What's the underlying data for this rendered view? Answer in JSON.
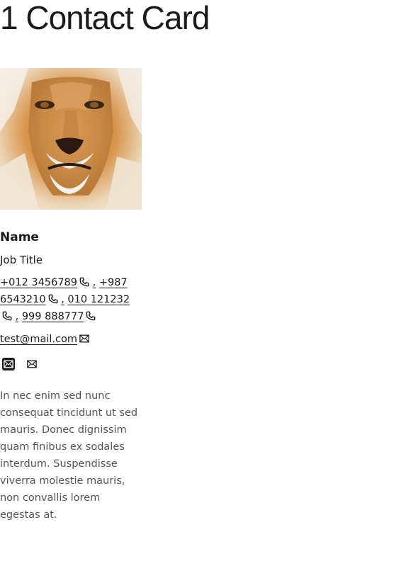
{
  "page": {
    "title": "1 Contact Card"
  },
  "card": {
    "photo_alt": "lion portrait",
    "name": "Name",
    "job_title": "Job Title",
    "phones": [
      {
        "number": "+012 3456789",
        "icon": "phone-icon"
      },
      {
        "number": "+987 6543210",
        "icon": "phone-icon"
      },
      {
        "number": "010 121232",
        "icon": "phone-icon"
      },
      {
        "number": "999 888777",
        "icon": "phone-icon"
      }
    ],
    "separator": ",",
    "email": {
      "address": "test@mail.com",
      "icon": "mail-icon"
    },
    "social_links": [
      {
        "icon": "mail-filled-icon"
      },
      {
        "icon": "mail-outline-icon"
      }
    ],
    "bio": "In nec enim sed nunc consequat tincidunt ut sed mauris. Donec dignissim quam finibus ex sodales interdum. Suspendisse viverra molestie mauris, non convallis lorem egestas at."
  },
  "colors": {
    "text": "#1b1b1b",
    "muted_text": "#555555",
    "background": "#ffffff"
  }
}
